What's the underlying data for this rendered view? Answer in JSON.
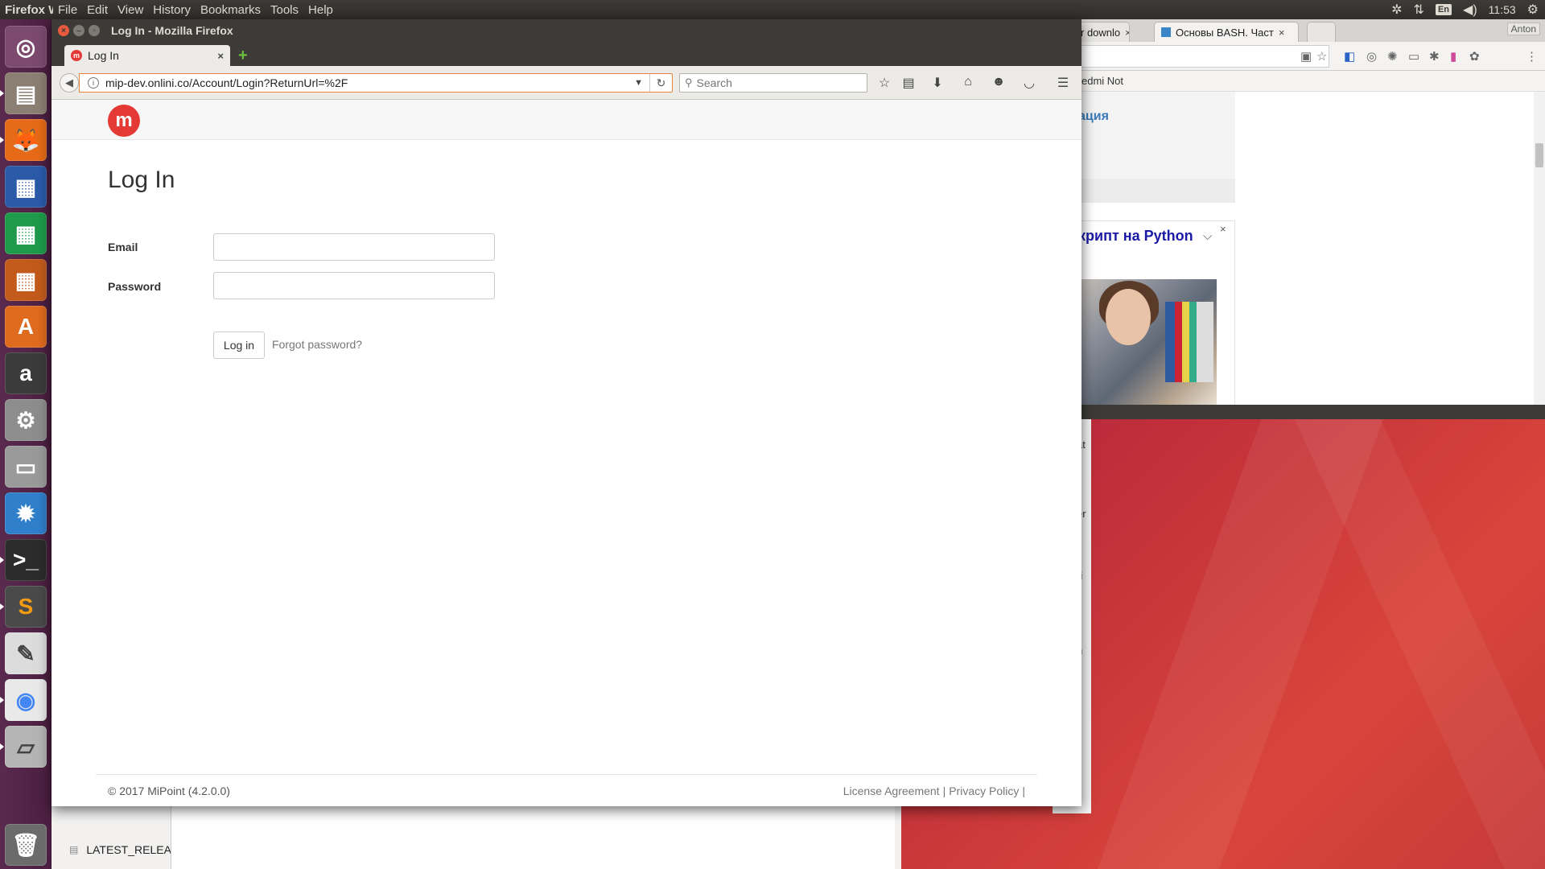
{
  "top_panel": {
    "app_name": "Firefox Web Browser",
    "menus": [
      "File",
      "Edit",
      "View",
      "History",
      "Bookmarks",
      "Tools",
      "Help"
    ],
    "keyboard_layout": "En",
    "time": "11:53"
  },
  "launcher": {
    "items": [
      {
        "name": "ubuntu-dash",
        "glyph": "◎",
        "bg": "#7b4a6e"
      },
      {
        "name": "files",
        "glyph": "▤",
        "bg": "#8a7f72"
      },
      {
        "name": "firefox",
        "glyph": "🦊",
        "bg": "#e66a17"
      },
      {
        "name": "libreoffice-writer",
        "glyph": "▦",
        "bg": "#2a5aa8"
      },
      {
        "name": "libreoffice-calc",
        "glyph": "▦",
        "bg": "#1e9a4a"
      },
      {
        "name": "libreoffice-impress",
        "glyph": "▦",
        "bg": "#c25a1c"
      },
      {
        "name": "software-center",
        "glyph": "A",
        "bg": "#e06a1d"
      },
      {
        "name": "amazon",
        "glyph": "a",
        "bg": "#3b3b3b"
      },
      {
        "name": "system-settings",
        "glyph": "⚙",
        "bg": "#8d8d8d"
      },
      {
        "name": "printer",
        "glyph": "▭",
        "bg": "#9a9a9a"
      },
      {
        "name": "system-monitor",
        "glyph": "✹",
        "bg": "#2f7fcb"
      },
      {
        "name": "terminal",
        "glyph": ">_",
        "bg": "#2c2c2c"
      },
      {
        "name": "sublime-text",
        "glyph": "S",
        "bg": "#4a4a4a"
      },
      {
        "name": "text-editor",
        "glyph": "✎",
        "bg": "#dcdcdc"
      },
      {
        "name": "chrome",
        "glyph": "◉",
        "bg": "#e9e9e9"
      },
      {
        "name": "disk",
        "glyph": "▱",
        "bg": "#b5b5b5"
      },
      {
        "name": "trash",
        "glyph": "🗑",
        "bg": "#6b6b6b"
      }
    ]
  },
  "chrome": {
    "tab1": "r downlo",
    "tab2": "Основы BASH. Част",
    "user": "Anton",
    "bookmark_text": "edmi Not",
    "side_link": "ация",
    "ad_title": "крипт на Python",
    "strip_letters": [
      "at",
      "er",
      "ri",
      "n",
      "s"
    ]
  },
  "files": {
    "file_name": "LATEST_RELEA"
  },
  "firefox": {
    "window_title": "Log In - Mozilla Firefox",
    "tab_title": "Log In",
    "url": "mip-dev.onlini.co/Account/Login?ReturnUrl=%2F",
    "search_placeholder": "Search"
  },
  "page": {
    "logo": "m",
    "title": "Log In",
    "email_label": "Email",
    "password_label": "Password",
    "login_button": "Log in",
    "forgot_link": "Forgot password?",
    "footer_copy": "© 2017 MiPoint (4.2.0.0)",
    "footer_license": "License Agreement",
    "footer_privacy": "Privacy Policy",
    "footer_sep": "|"
  }
}
